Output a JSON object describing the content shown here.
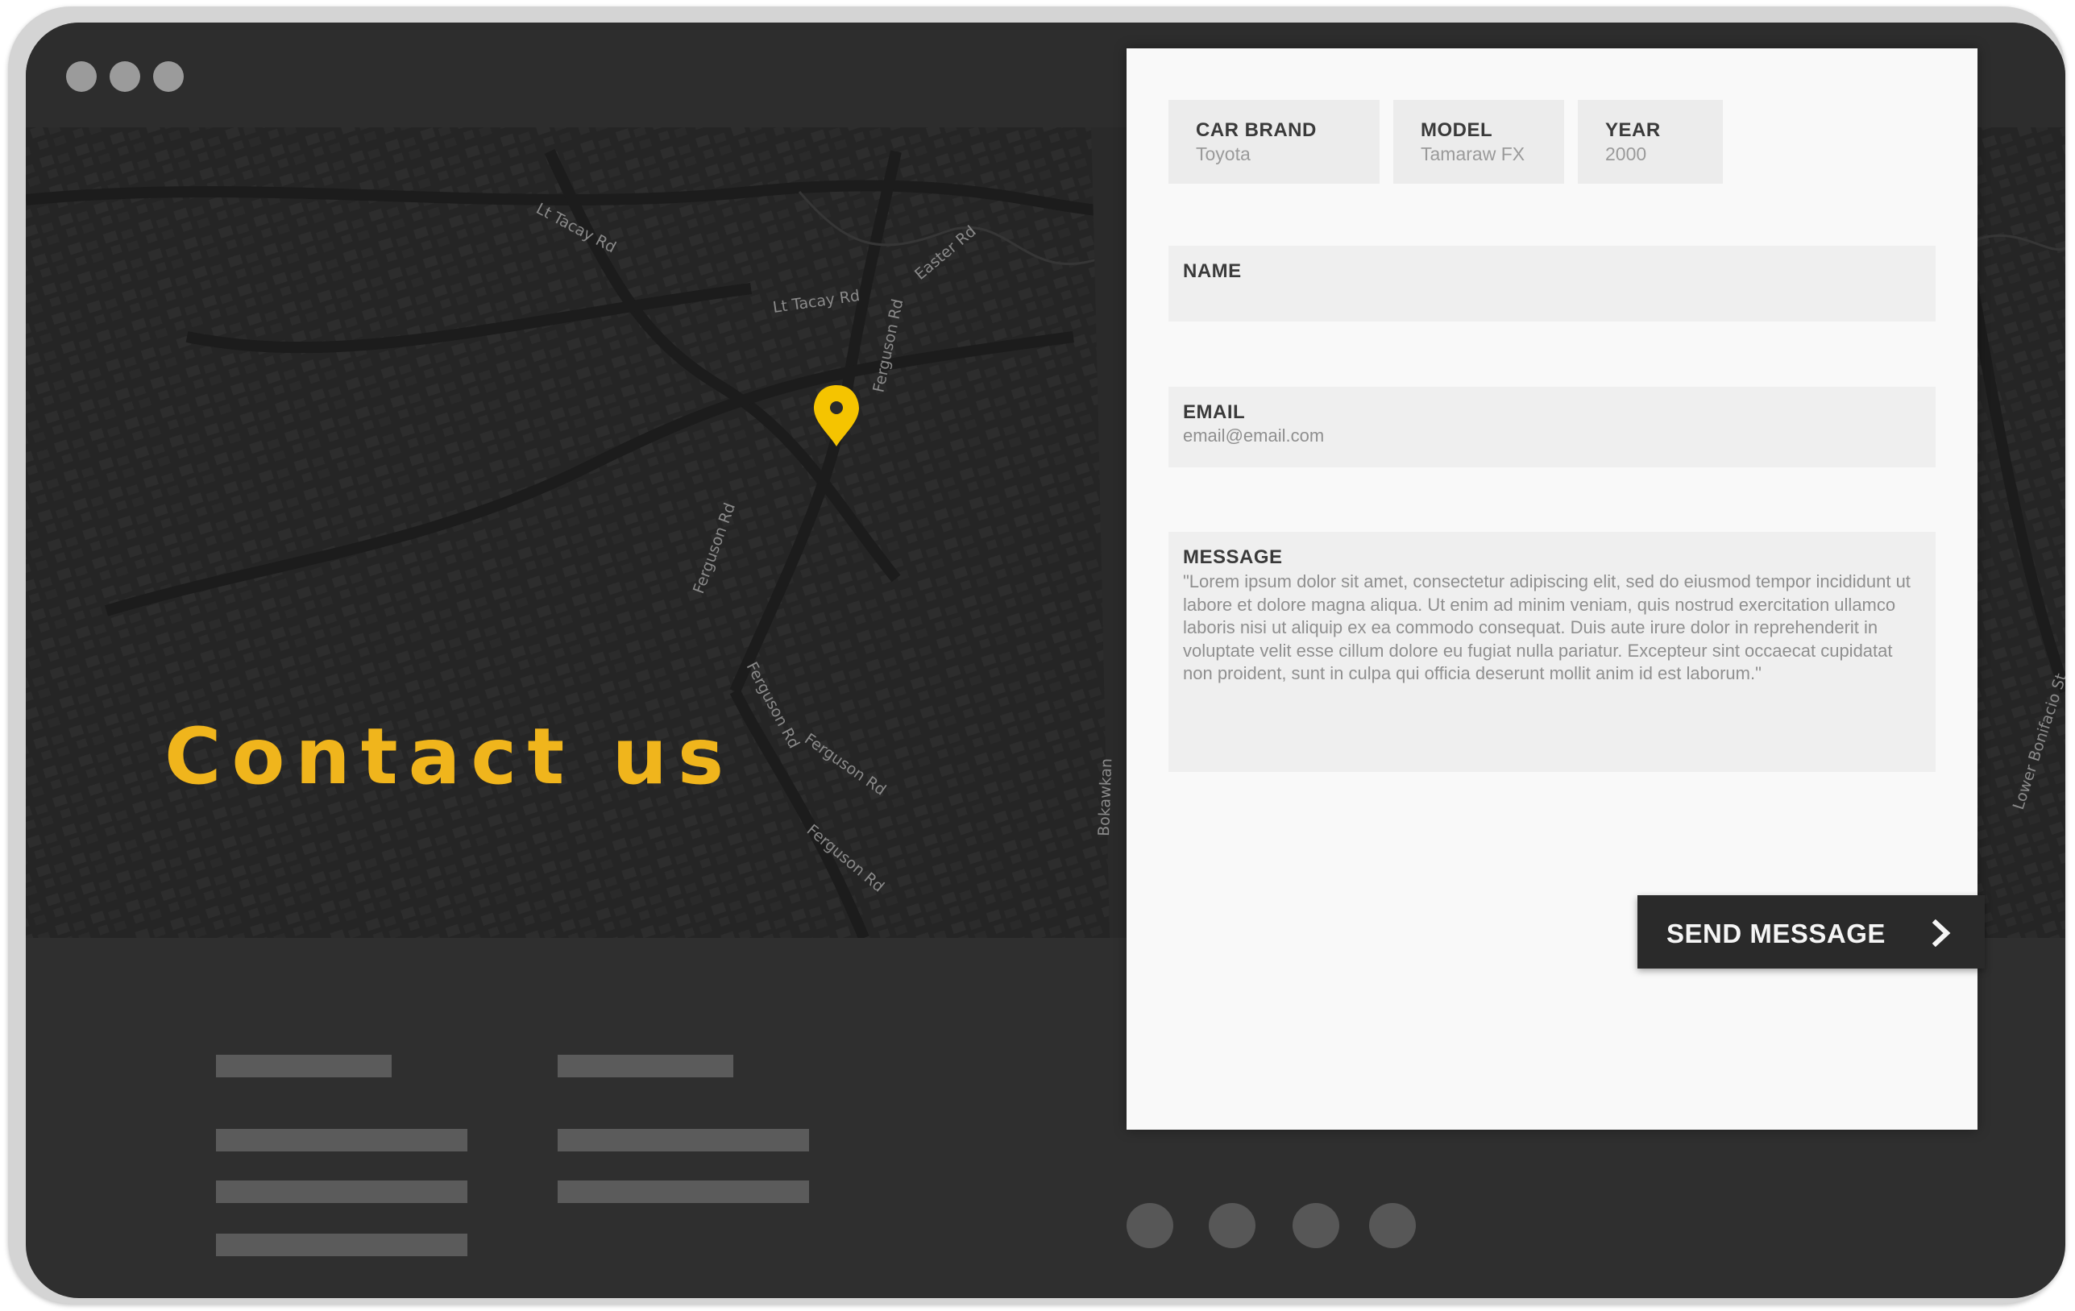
{
  "window": {
    "controls": [
      "window-dot",
      "window-dot",
      "window-dot"
    ]
  },
  "map": {
    "street_labels": [
      "Lt Tacay Rd",
      "Lt Tacay Rd",
      "Easter Rd",
      "Ferguson Rd",
      "Ferguson Rd",
      "Ferguson Rd",
      "Ferguson Rd",
      "Ferguson Rd",
      "Bokawkan",
      "Lower Bonifacio St"
    ],
    "pin_icon": "location-pin-icon",
    "pin_color": "#f5c400"
  },
  "hero": {
    "title": "Contact us",
    "title_color": "#f0b51c"
  },
  "form": {
    "car_brand": {
      "label": "CAR BRAND",
      "value": "Toyota"
    },
    "model": {
      "label": "MODEL",
      "value": "Tamaraw FX"
    },
    "year": {
      "label": "YEAR",
      "value": "2000"
    },
    "name": {
      "label": "NAME",
      "value": ""
    },
    "email": {
      "label": "EMAIL",
      "placeholder": "email@email.com"
    },
    "message": {
      "label": "MESSAGE",
      "value": "\"Lorem ipsum dolor sit amet, consectetur adipiscing elit, sed do eiusmod tempor incididunt ut labore et dolore magna aliqua. Ut enim ad minim veniam, quis nostrud exercitation ullamco laboris nisi ut aliquip ex ea commodo consequat. Duis aute irure dolor in reprehenderit in voluptate velit esse cillum dolore eu fugiat nulla pariatur. Excepteur sint occaecat cupidatat non proident, sunt in culpa qui officia deserunt mollit anim id est laborum.\""
    },
    "send_button": {
      "label": "SEND MESSAGE",
      "icon": "chevron-right-icon"
    }
  },
  "pagination": {
    "dots": 4
  }
}
